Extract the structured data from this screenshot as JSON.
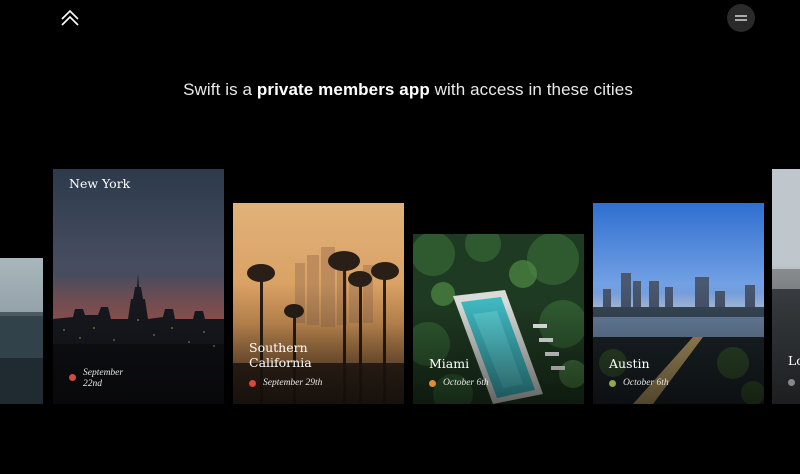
{
  "nav": {
    "logo_icon": "double-chevron-up-icon",
    "menu_icon": "hamburger-icon"
  },
  "headline": {
    "prefix": "Swift is a ",
    "emphasis": "private members app",
    "suffix": " with access in these cities"
  },
  "cities": [
    {
      "name": "New York",
      "date": "September 22nd",
      "dot_color": "#d9483b"
    },
    {
      "name": "Southern California",
      "date": "September 29th",
      "dot_color": "#d9483b"
    },
    {
      "name": "Miami",
      "date": "October 6th",
      "dot_color": "#e08a3a"
    },
    {
      "name": "Austin",
      "date": "October 6th",
      "dot_color": "#8fa84a"
    },
    {
      "name": "Lo",
      "date": "",
      "dot_color": "#888888"
    }
  ]
}
